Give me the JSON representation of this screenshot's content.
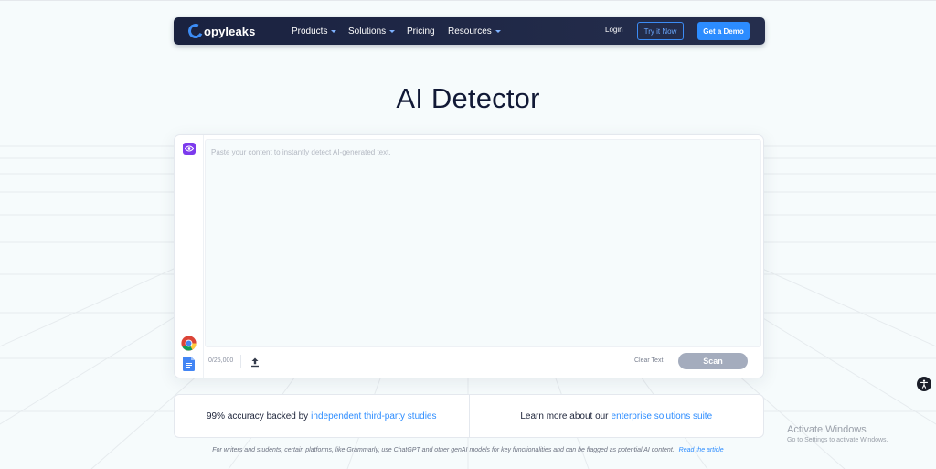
{
  "navbar": {
    "logo_text": "opyleaks",
    "items": [
      {
        "label": "Products",
        "has_dropdown": true
      },
      {
        "label": "Solutions",
        "has_dropdown": true
      },
      {
        "label": "Pricing",
        "has_dropdown": false
      },
      {
        "label": "Resources",
        "has_dropdown": true
      }
    ],
    "login_label": "Login",
    "try_label": "Try it Now",
    "demo_label": "Get a Demo"
  },
  "page": {
    "title": "AI Detector"
  },
  "editor": {
    "placeholder": "Paste your content to instantly detect AI-generated text.",
    "counter": "0/25,000",
    "clear_label": "Clear Text",
    "scan_label": "Scan",
    "side_icons": [
      "eye-icon",
      "chrome-icon",
      "google-docs-icon"
    ]
  },
  "info": {
    "left_text": "99% accuracy backed by",
    "left_link": "independent third-party studies",
    "right_text": "Learn more about our",
    "right_link": "enterprise solutions suite"
  },
  "disclaimer": {
    "text": "For writers and students, certain platforms, like Grammarly, use ChatGPT and other genAI models for key functionalities and can be flagged as potential AI content.",
    "link": "Read the article"
  },
  "watermark": {
    "title": "Activate Windows",
    "subtitle": "Go to Settings to activate Windows."
  },
  "colors": {
    "navbar_bg": "#1a2240",
    "accent_blue": "#2c8cff",
    "eye_purple": "#7c3aed",
    "scan_disabled": "#a4acbd",
    "title_text": "#111936"
  }
}
